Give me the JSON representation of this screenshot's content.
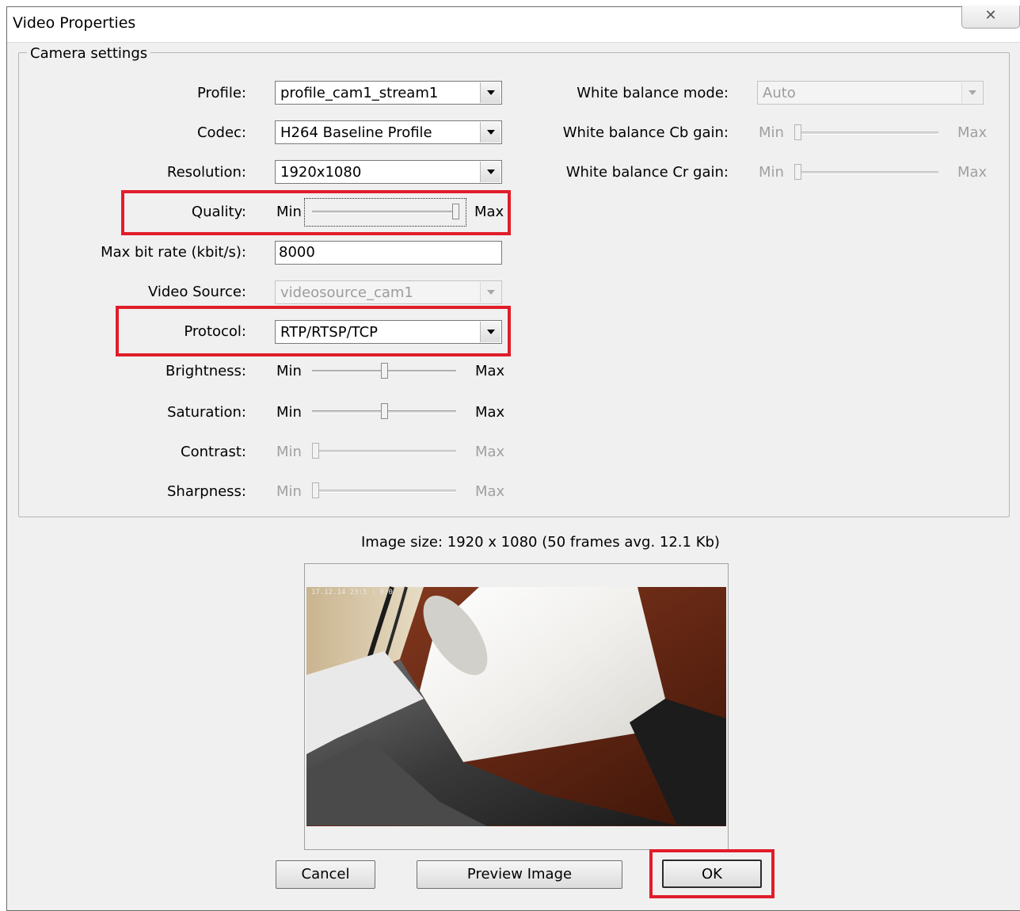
{
  "window": {
    "title": "Video Properties",
    "close_glyph": "✕"
  },
  "group": {
    "legend": "Camera settings"
  },
  "labels": {
    "profile": "Profile:",
    "codec": "Codec:",
    "resolution": "Resolution:",
    "quality": "Quality:",
    "max_bitrate": "Max bit rate (kbit/s):",
    "video_source": "Video Source:",
    "protocol": "Protocol:",
    "brightness": "Brightness:",
    "saturation": "Saturation:",
    "contrast": "Contrast:",
    "sharpness": "Sharpness:",
    "wb_mode": "White balance mode:",
    "wb_cb": "White balance Cb gain:",
    "wb_cr": "White balance Cr gain:"
  },
  "values": {
    "profile": "profile_cam1_stream1",
    "codec": "H264 Baseline Profile",
    "resolution": "1920x1080",
    "max_bitrate": "8000",
    "video_source": "videosource_cam1",
    "protocol": "RTP/RTSP/TCP",
    "wb_mode": "Auto"
  },
  "slider_text": {
    "min": "Min",
    "max": "Max"
  },
  "sliders": {
    "quality": 1.0,
    "brightness": 0.5,
    "saturation": 0.5,
    "contrast": 0.0,
    "sharpness": 0.0,
    "wb_cb": 0.0,
    "wb_cr": 0.0
  },
  "image_size": "Image size: 1920 x 1080 (50 frames avg. 12.1 Kb)",
  "preview": {
    "overlay_text": "17.12.14 23:5 : 0:0"
  },
  "buttons": {
    "cancel": "Cancel",
    "preview": "Preview Image",
    "ok": "OK"
  },
  "colors": {
    "highlight": "#e11d2a",
    "dialog_bg": "#f0f0f0"
  }
}
